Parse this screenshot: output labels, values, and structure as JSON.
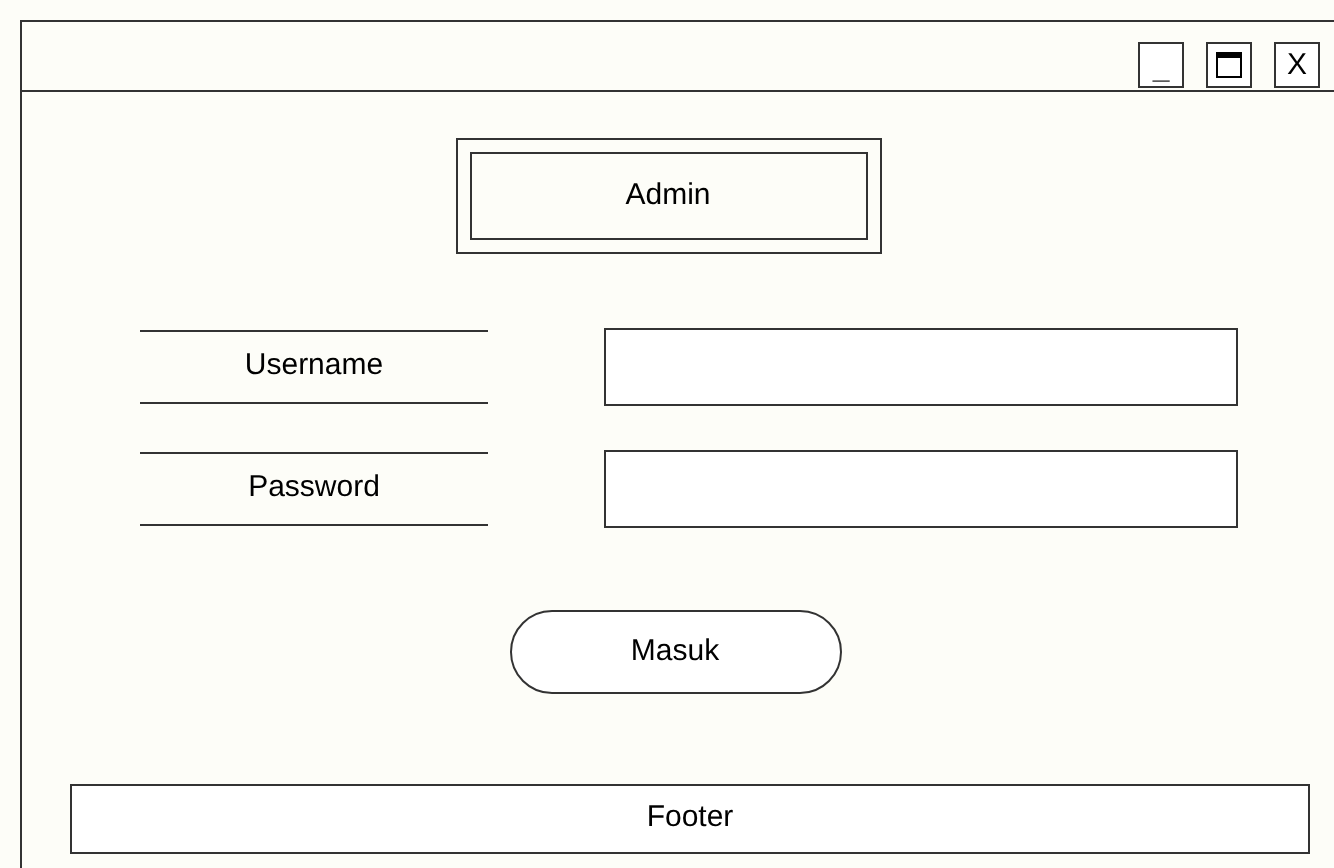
{
  "window": {
    "controls": [
      {
        "kind": "minimize",
        "label": "_"
      },
      {
        "kind": "maximize"
      },
      {
        "kind": "close",
        "label": "X"
      }
    ]
  },
  "header": {
    "title": "Admin"
  },
  "form": {
    "fields": [
      {
        "label": "Username"
      },
      {
        "label": "Password"
      }
    ],
    "submit": "Masuk"
  },
  "footer": {
    "text": "Footer"
  }
}
